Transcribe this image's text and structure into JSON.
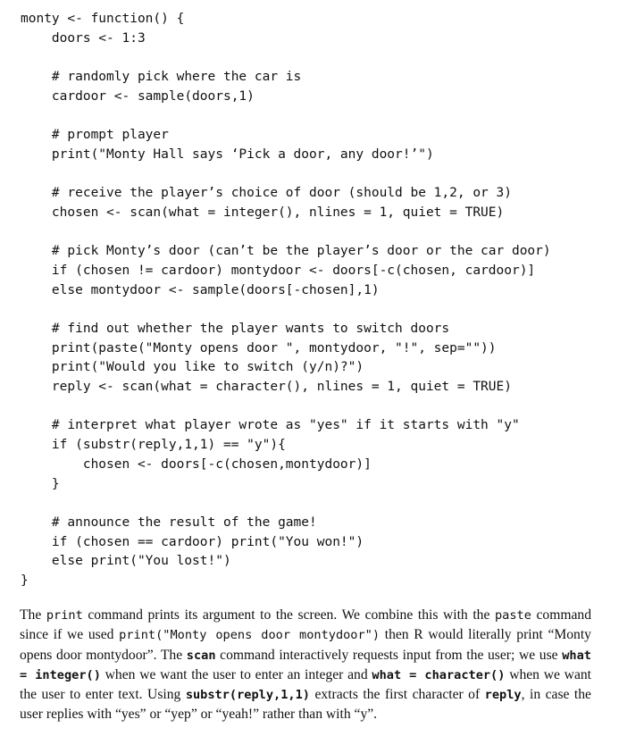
{
  "code": {
    "lines": [
      "monty <- function() {",
      "    doors <- 1:3",
      "",
      "    # randomly pick where the car is",
      "    cardoor <- sample(doors,1)",
      "",
      "    # prompt player",
      "    print(\"Monty Hall says ‘Pick a door, any door!’\")",
      "",
      "    # receive the player’s choice of door (should be 1,2, or 3)",
      "    chosen <- scan(what = integer(), nlines = 1, quiet = TRUE)",
      "",
      "    # pick Monty’s door (can’t be the player’s door or the car door)",
      "    if (chosen != cardoor) montydoor <- doors[-c(chosen, cardoor)]",
      "    else montydoor <- sample(doors[-chosen],1)",
      "",
      "    # find out whether the player wants to switch doors",
      "    print(paste(\"Monty opens door \", montydoor, \"!\", sep=\"\"))",
      "    print(\"Would you like to switch (y/n)?\")",
      "    reply <- scan(what = character(), nlines = 1, quiet = TRUE)",
      "",
      "    # interpret what player wrote as \"yes\" if it starts with \"y\"",
      "    if (substr(reply,1,1) == \"y\"){",
      "        chosen <- doors[-c(chosen,montydoor)]",
      "    }",
      "",
      "    # announce the result of the game!",
      "    if (chosen == cardoor) print(\"You won!\")",
      "    else print(\"You lost!\")",
      "}"
    ]
  },
  "prose": {
    "t1": "The ",
    "c1": "print",
    "t2": " command prints its argument to the screen. We combine this with the ",
    "c2": "paste",
    "t3": " command since if we used ",
    "c3": "print(\"Monty opens door montydoor\")",
    "t4": " then R would literally print “Monty opens door montydoor”. The ",
    "c4": "scan",
    "t5": " command interactively requests input from the user; we use ",
    "c5": "what = integer()",
    "t6": " when we want the user to enter an integer and ",
    "c6": "what = character()",
    "t7": " when we want the user to enter text. Using ",
    "c7": "substr(reply,1,1)",
    "t8": " extracts the first character of ",
    "c8": "reply",
    "t9": ", in case the user replies with “yes” or “yep” or “yeah!” rather than with “y”."
  }
}
